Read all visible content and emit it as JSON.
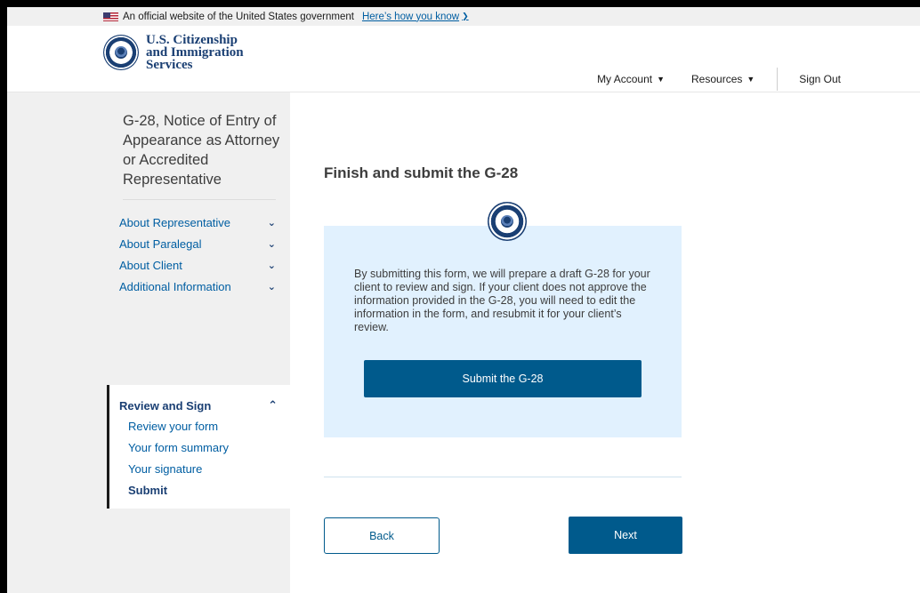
{
  "gov_banner": {
    "text": "An official website of the United States government",
    "link": "Here’s how you know"
  },
  "header": {
    "logo_lines": [
      "U.S. Citizenship",
      "and Immigration",
      "Services"
    ],
    "nav": {
      "account": "My Account",
      "resources": "Resources",
      "sign_out": "Sign Out"
    }
  },
  "sidebar": {
    "title": "G-28, Notice of Entry of Appearance as Attorney or Accredited Representative",
    "sections": [
      {
        "label": "About Representative"
      },
      {
        "label": "About Paralegal"
      },
      {
        "label": "About Client"
      },
      {
        "label": "Additional Information"
      }
    ],
    "review": {
      "label": "Review and Sign",
      "items": [
        {
          "label": "Review your form"
        },
        {
          "label": "Your form summary"
        },
        {
          "label": "Your signature"
        },
        {
          "label": "Submit",
          "current": true
        }
      ]
    }
  },
  "main": {
    "title": "Finish and submit the G-28",
    "info": "By submitting this form, we will prepare a draft G-28 for your client to review and sign. If your client does not approve the information provided in the G-28, you will need to edit the information in the form, and resubmit it for your client’s review.",
    "submit_label": "Submit the G-28",
    "back_label": "Back",
    "next_label": "Next"
  },
  "colors": {
    "primary": "#005a8c",
    "link": "#005ea2",
    "info_bg": "#e1f1fe",
    "sidebar_bg": "#f0f0f0",
    "brand_navy": "#1a3f73"
  }
}
